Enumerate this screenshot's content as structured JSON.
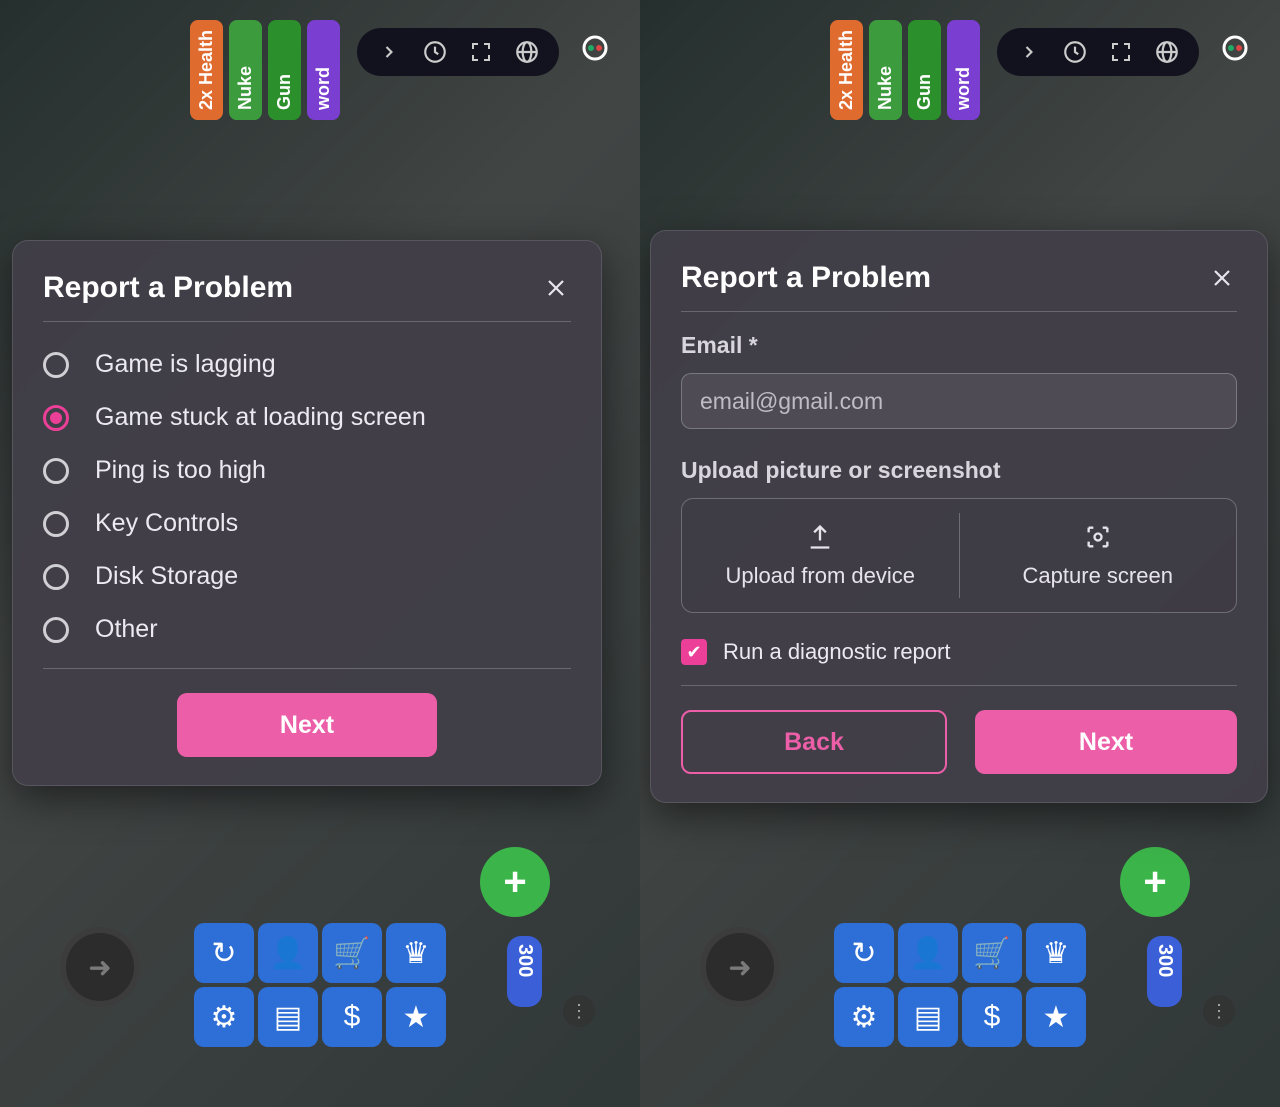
{
  "background": {
    "side_pills": [
      "2x Health",
      "Nuke",
      "Gun",
      "word"
    ],
    "counter": "300"
  },
  "modal_left": {
    "title": "Report a Problem",
    "options": [
      {
        "label": "Game is lagging",
        "selected": false
      },
      {
        "label": "Game stuck at loading screen",
        "selected": true
      },
      {
        "label": "Ping is too high",
        "selected": false
      },
      {
        "label": "Key Controls",
        "selected": false
      },
      {
        "label": "Disk Storage",
        "selected": false
      },
      {
        "label": "Other",
        "selected": false
      }
    ],
    "next_label": "Next"
  },
  "modal_right": {
    "title": "Report a Problem",
    "email_label": "Email *",
    "email_placeholder": "email@gmail.com",
    "upload_label": "Upload picture or screenshot",
    "upload_from_device": "Upload from device",
    "capture_screen": "Capture screen",
    "diagnostic_label": "Run a diagnostic report",
    "diagnostic_checked": true,
    "back_label": "Back",
    "next_label": "Next"
  },
  "colors": {
    "accent": "#ec5fa8",
    "accent_strong": "#ec3f98"
  }
}
